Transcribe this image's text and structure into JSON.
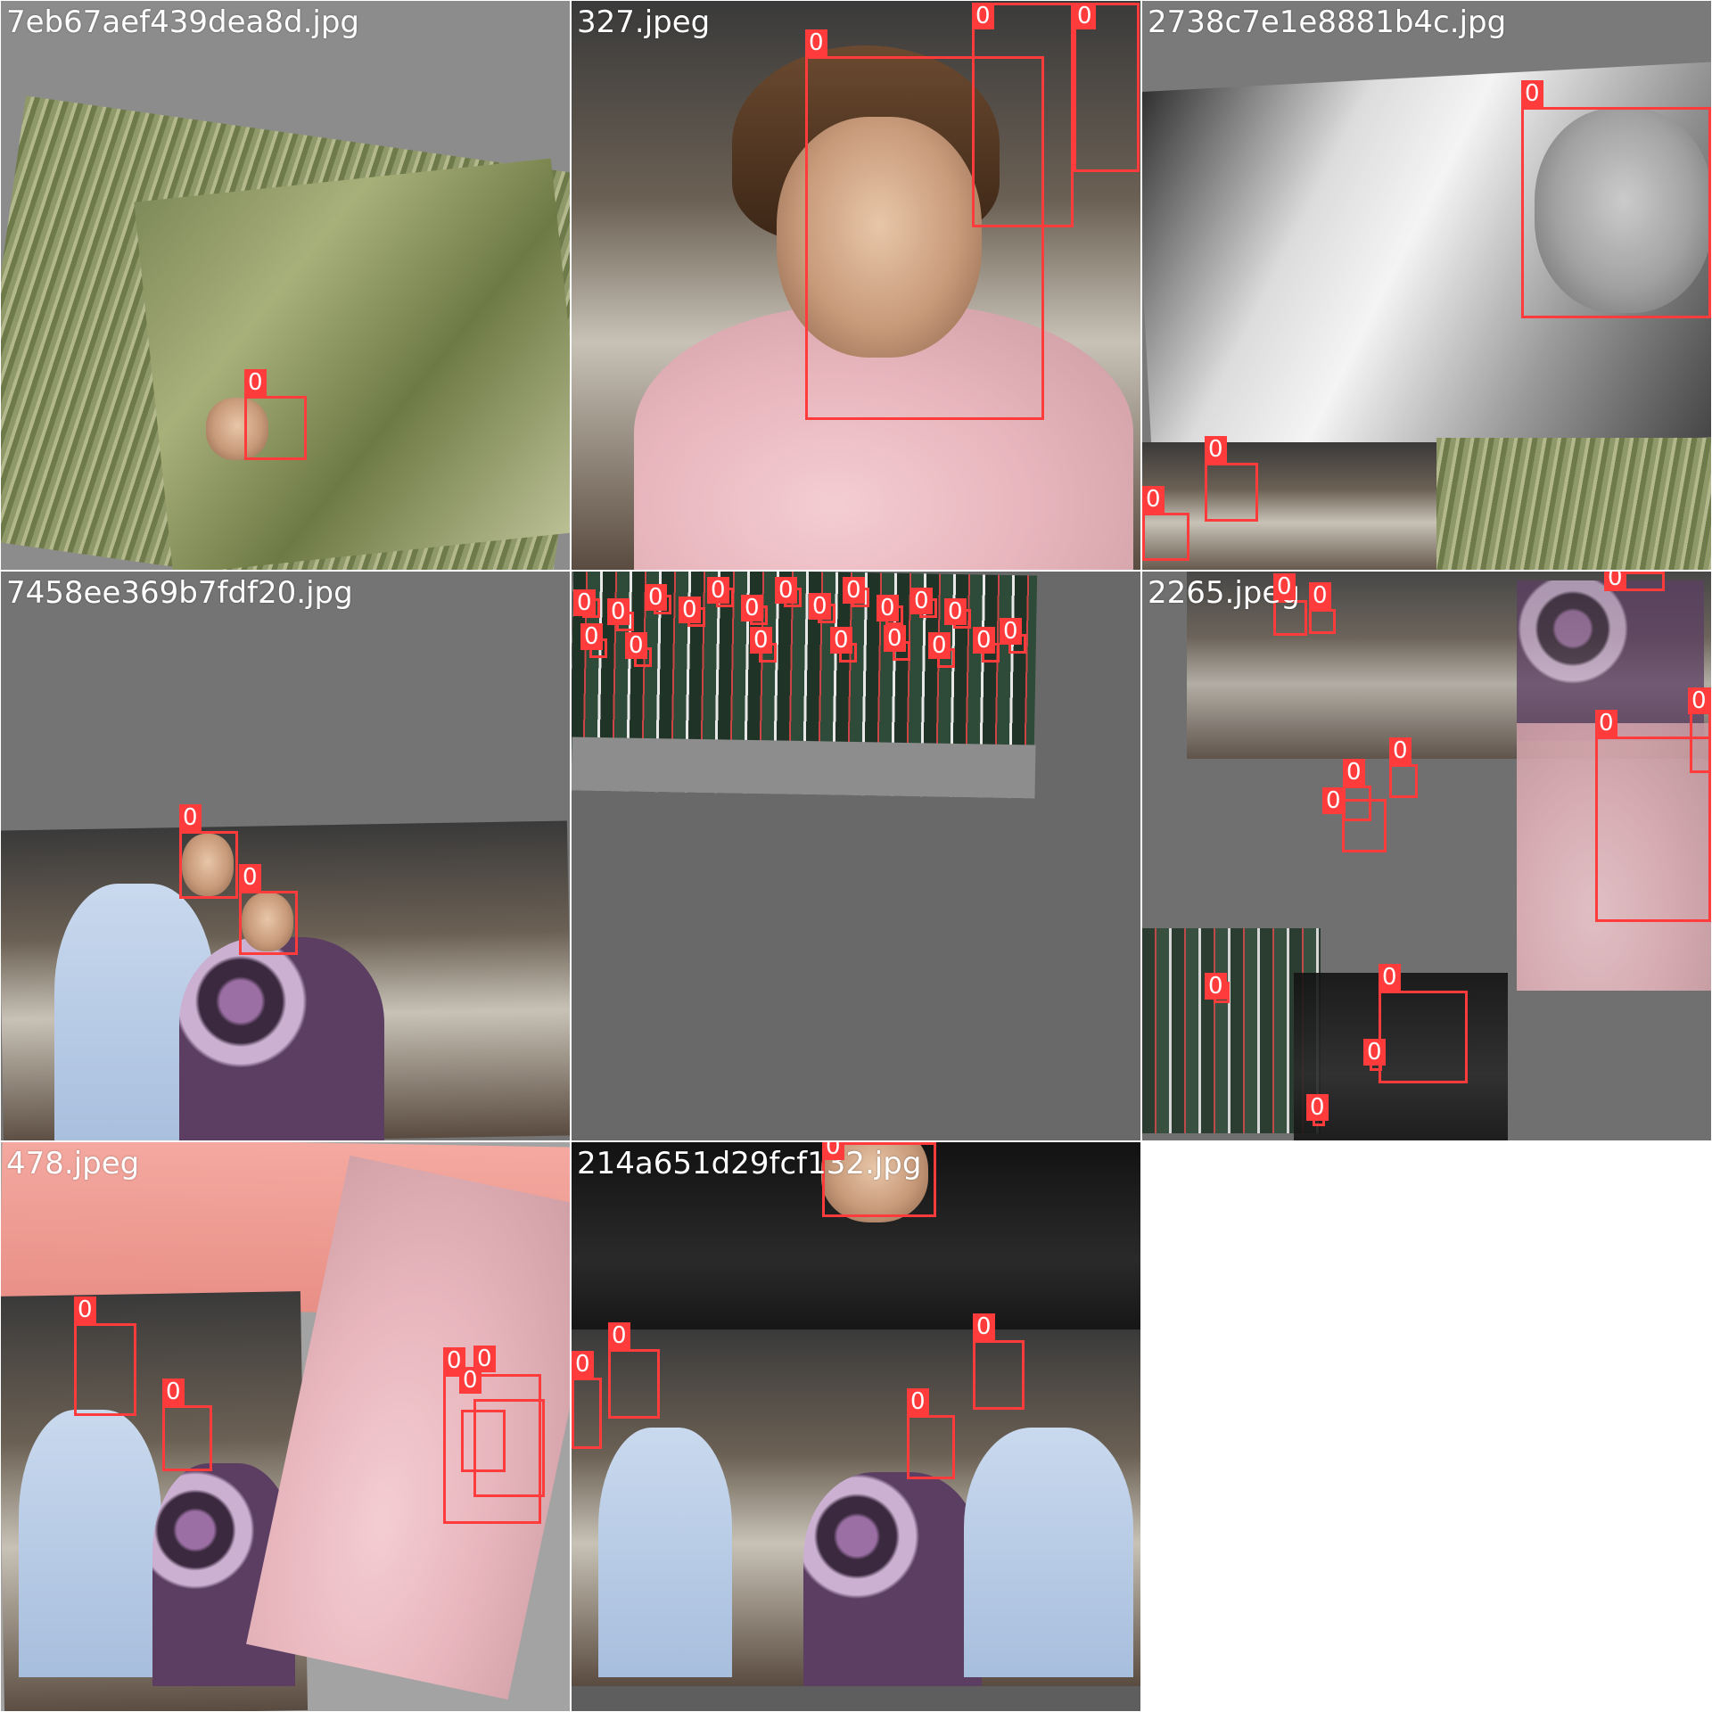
{
  "mosaic": {
    "tiles": [
      {
        "filename": "7eb67aef439dea8d.jpg",
        "detections": [
          "0"
        ]
      },
      {
        "filename": "327.jpeg",
        "detections": [
          "0",
          "0",
          "0"
        ]
      },
      {
        "filename": "2738c7e1e8881b4c.jpg",
        "detections": [
          "0",
          "0",
          "0"
        ]
      },
      {
        "filename": "7458ee369b7fdf20.jpg",
        "detections": [
          "0",
          "0"
        ]
      },
      {
        "filename": "",
        "detections": [
          "0",
          "0",
          "0",
          "0",
          "0",
          "0",
          "0",
          "0",
          "0",
          "0",
          "0",
          "0",
          "0",
          "0",
          "0",
          "0",
          "0",
          "0",
          "0",
          "0"
        ]
      },
      {
        "filename": "2265.jpeg",
        "detections": [
          "0",
          "0",
          "0",
          "0",
          "0",
          "0",
          "0",
          "0",
          "0",
          "0",
          "0",
          "0"
        ]
      },
      {
        "filename": "478.jpeg",
        "detections": [
          "0",
          "0",
          "0",
          "0",
          "0"
        ]
      },
      {
        "filename": "214a651d29fcf132.jpg",
        "detections": [
          "0",
          "0",
          "0",
          "0",
          "0"
        ]
      }
    ],
    "box_color": "#ff3b3b",
    "class_label": "0"
  }
}
